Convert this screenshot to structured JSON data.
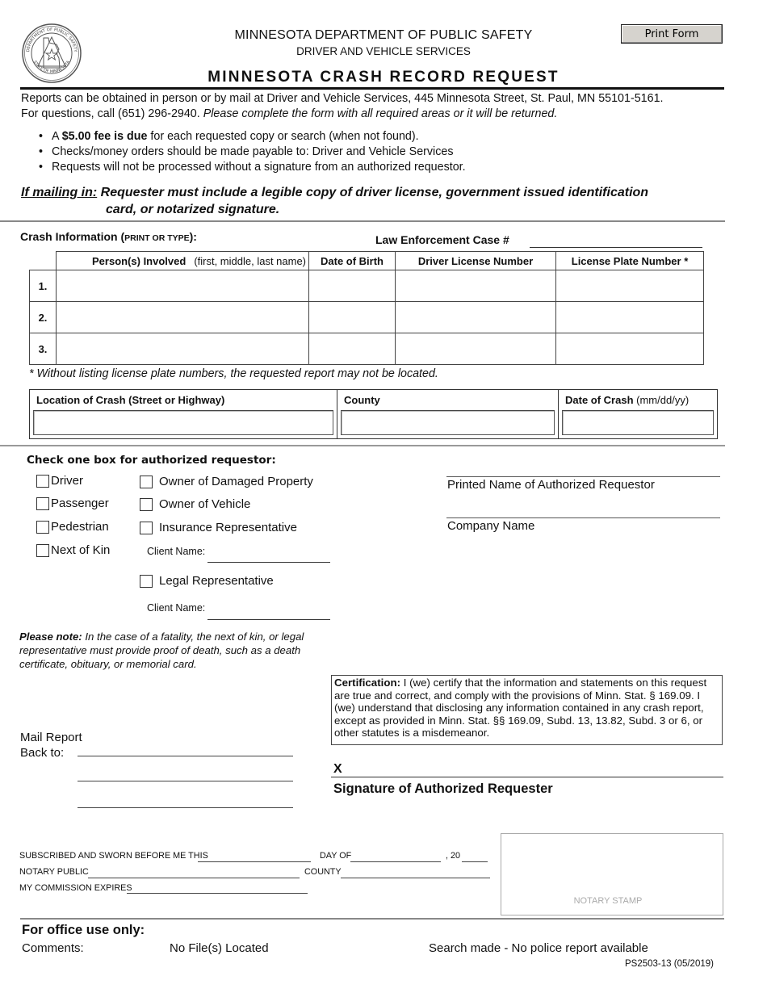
{
  "header": {
    "agency": "MINNESOTA  DEPARTMENT OF PUBLIC SAFETY",
    "division": "DRIVER AND VEHICLE SERVICES",
    "form_title": "MINNESOTA CRASH RECORD REQUEST",
    "print_button": "Print Form",
    "seal": {
      "top_text": "DEPARTMENT OF PUBLIC SAFETY",
      "bottom_text": "STATE OF MINNESOTA"
    }
  },
  "intro": {
    "line1": "Reports can be obtained in person or by mail at Driver and Vehicle Services, 445 Minnesota Street, St. Paul, MN 55101-5161.",
    "line2_plain": "For questions, call (651) 296-2940. ",
    "line2_italic": "Please complete the form with all required areas or it will be returned.",
    "bullets": [
      {
        "prefix": "A ",
        "bold": "$5.00 fee is due",
        "rest": " for each requested copy or search (when not found)."
      },
      {
        "prefix": "Checks/money orders should be made payable to: Driver and Vehicle Services",
        "bold": "",
        "rest": ""
      },
      {
        "prefix": "Requests will not be processed without a signature from an authorized requestor.",
        "bold": "",
        "rest": ""
      }
    ],
    "mailing_lead": "If mailing in:",
    "mailing_text_1": " Requester must include a legible copy of driver license, government issued identification",
    "mailing_text_2": "card, or notarized signature."
  },
  "crash_info": {
    "label": "Crash Information  (",
    "label_small": "PRINT OR TYPE",
    "label_end": "):",
    "case_label": "Law Enforcement Case #",
    "case_value": "",
    "columns": {
      "persons": "Person(s) Involved",
      "persons_hint": "(first, middle, last name)",
      "dob": "Date of Birth",
      "dl": "Driver License Number",
      "plate": "License Plate Number *"
    },
    "rows": [
      {
        "num": "1.",
        "person": "",
        "dob": "",
        "dl": "",
        "plate": ""
      },
      {
        "num": "2.",
        "person": "",
        "dob": "",
        "dl": "",
        "plate": ""
      },
      {
        "num": "3.",
        "person": "",
        "dob": "",
        "dl": "",
        "plate": ""
      }
    ],
    "plate_note": "* Without listing license plate numbers, the requested report may not be located."
  },
  "location": {
    "location_label": "Location of Crash (Street or Highway)",
    "county_label": "County",
    "date_label": "Date of Crash",
    "date_hint": " (mm/dd/yy)",
    "location_value": "",
    "county_value": "",
    "date_value": ""
  },
  "requestor": {
    "title": "Check one box for authorized requestor:",
    "left_options": [
      "Driver",
      "Passenger",
      "Pedestrian",
      "Next of Kin"
    ],
    "right_options": [
      "Owner of Damaged Property",
      "Owner of Vehicle",
      "Insurance Representative",
      "Legal Representative"
    ],
    "client_name_label": "Client Name:",
    "printed_name_label": "Printed Name of Authorized Requestor",
    "company_name_label": "Company Name"
  },
  "note": {
    "lead": "Please note:",
    "text": " In the case of a fatality, the next of kin, or legal representative must provide proof of death, such as a death certificate, obituary, or memorial card."
  },
  "mail_back": {
    "line1": "Mail Report",
    "line2": "Back to:"
  },
  "certification": {
    "lead": "Certification:",
    "text": " I (we) certify that the information and statements on this request are true and correct, and comply with the provisions of Minn. Stat. § 169.09.  I (we) understand that disclosing any information contained in any crash report, except as provided in Minn. Stat. §§ 169.09, Subd. 13, 13.82, Subd. 3 or 6, or other statutes is a misdemeanor."
  },
  "signature": {
    "mark": "X",
    "label": "Signature of Authorized Requester"
  },
  "notary": {
    "sworn": "SUBSCRIBED AND SWORN BEFORE ME THIS",
    "day_of": "DAY OF",
    "year_prefix": ", 20",
    "notary_public": "NOTARY PUBLIC",
    "county": "COUNTY",
    "commission": "MY COMMISSION EXPIRES",
    "stamp": "NOTARY STAMP"
  },
  "office": {
    "title": "For office use only:",
    "comments": "Comments:",
    "no_file": "No File(s) Located",
    "search_made": "Search made - No police report available"
  },
  "form_id": "PS2503-13 (05/2019)"
}
